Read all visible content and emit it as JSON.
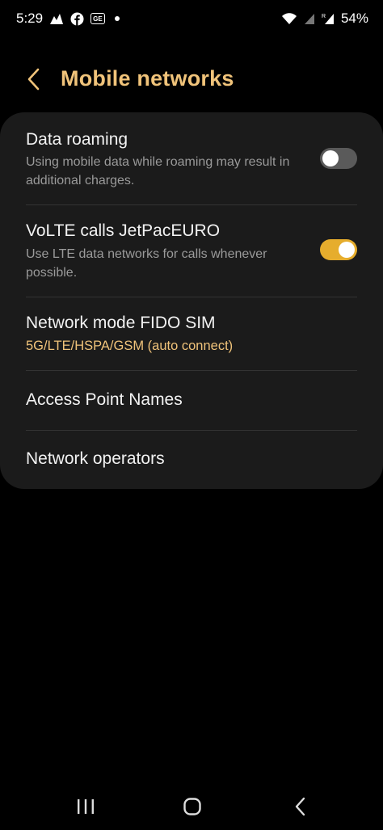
{
  "status_bar": {
    "time": "5:29",
    "icons_left": [
      "activity-icon",
      "facebook-icon",
      "ge-badge-icon",
      "notification-dot-icon"
    ],
    "ge_badge": "GE",
    "icons_right": [
      "wifi-icon",
      "signal-icon",
      "roaming-signal-icon"
    ],
    "battery_percent": "54%"
  },
  "header": {
    "title": "Mobile networks",
    "back_icon": "chevron-left-icon"
  },
  "settings": {
    "data_roaming": {
      "title": "Data roaming",
      "description": "Using mobile data while roaming may result in additional charges.",
      "enabled": false
    },
    "volte": {
      "title": "VoLTE calls JetPacEURO",
      "description": "Use LTE data networks for calls whenever possible.",
      "enabled": true
    },
    "network_mode": {
      "title": "Network mode FIDO SIM",
      "value": "5G/LTE/HSPA/GSM (auto connect)"
    },
    "apn": {
      "title": "Access Point Names"
    },
    "operators": {
      "title": "Network operators"
    }
  },
  "colors": {
    "accent": "#f0c37a",
    "toggle_on": "#e6ad2d",
    "toggle_off": "#5a5a5a",
    "card_bg": "#1b1b1b",
    "background": "#000000"
  },
  "nav_bar": {
    "icons": [
      "recent-apps-icon",
      "home-icon",
      "back-icon"
    ]
  }
}
